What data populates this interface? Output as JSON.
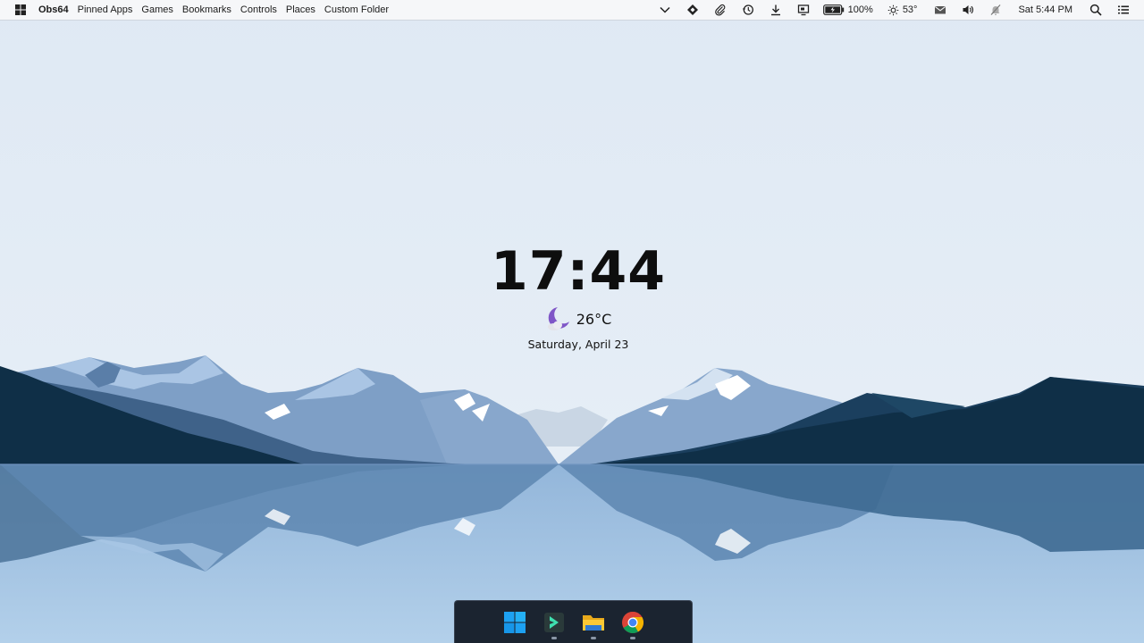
{
  "menubar": {
    "items": [
      {
        "label": "Obs64",
        "bold": true
      },
      {
        "label": "Pinned Apps"
      },
      {
        "label": "Games"
      },
      {
        "label": "Bookmarks"
      },
      {
        "label": "Controls"
      },
      {
        "label": "Places"
      },
      {
        "label": "Custom Folder"
      }
    ],
    "tray": {
      "battery_percent": "100%",
      "weather_temp": "53°",
      "datetime": "Sat 5:44 PM"
    }
  },
  "clock_widget": {
    "time": "17:44",
    "temperature": "26°C",
    "date": "Saturday, April 23"
  },
  "dock": {
    "apps": [
      {
        "name": "start-menu-app",
        "icon": "windows-logo-icon",
        "running": false
      },
      {
        "name": "filmora-app",
        "icon": "filmora-icon",
        "running": true
      },
      {
        "name": "file-explorer-app",
        "icon": "folder-icon",
        "running": true
      },
      {
        "name": "chrome-app",
        "icon": "chrome-icon",
        "running": true
      }
    ]
  },
  "colors": {
    "sky": "#dfe9f3",
    "lake": "#a9c8e6",
    "dark_mountain": "#0f2f47",
    "mid_mountain": "#6b8fba",
    "dock_bg": "#1b2430",
    "weather_accent": "#7f56c7"
  }
}
